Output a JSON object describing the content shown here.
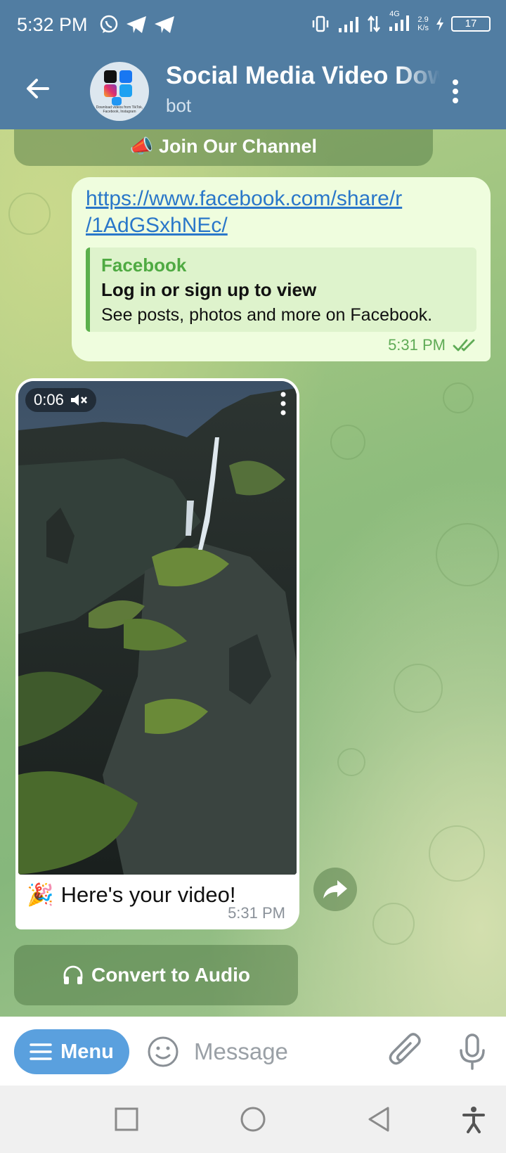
{
  "status_bar": {
    "time": "5:32 PM",
    "network_type": "4G",
    "net_speed_value": "2.9",
    "net_speed_unit": "K/s",
    "battery": "17"
  },
  "header": {
    "title": "Social Media Video Dow",
    "subtitle": "bot",
    "avatar_caption": "Download videos from TikTok, Facebook, Instagram"
  },
  "messages": {
    "join_channel_label": "📣 Join Our Channel",
    "outgoing": {
      "link_line1": "https://www.facebook.com/share/r",
      "link_line2": "/1AdGSxhNEc/",
      "preview_site": "Facebook",
      "preview_title": "Log in or sign up to view",
      "preview_description": "See posts, photos and more on Facebook.",
      "time": "5:31 PM"
    },
    "incoming": {
      "video_duration": "0:06",
      "caption_emoji": "🎉",
      "caption": "Here's your video!",
      "time": "5:31 PM"
    },
    "convert_audio_label": "Convert to Audio"
  },
  "input_bar": {
    "menu_label": "Menu",
    "placeholder": "Message"
  },
  "colors": {
    "header_bg": "#517da2",
    "outgoing_bubble": "#effdde",
    "link": "#2a77c9",
    "accent_green": "#4faa42",
    "menu_button": "#5aa0de"
  }
}
